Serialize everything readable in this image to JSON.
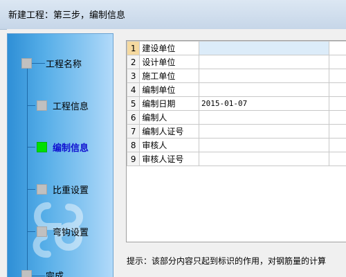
{
  "window": {
    "title": "新建工程：第三步，编制信息"
  },
  "steps": [
    {
      "label": "工程名称",
      "active": false
    },
    {
      "label": "工程信息",
      "active": false
    },
    {
      "label": "编制信息",
      "active": true
    },
    {
      "label": "比重设置",
      "active": false
    },
    {
      "label": "弯钩设置",
      "active": false
    },
    {
      "label": "完成",
      "active": false
    }
  ],
  "grid": {
    "rows": [
      {
        "num": "1",
        "name": "建设单位",
        "value": ""
      },
      {
        "num": "2",
        "name": "设计单位",
        "value": ""
      },
      {
        "num": "3",
        "name": "施工单位",
        "value": ""
      },
      {
        "num": "4",
        "name": "编制单位",
        "value": ""
      },
      {
        "num": "5",
        "name": "编制日期",
        "value": "2015-01-07"
      },
      {
        "num": "6",
        "name": "编制人",
        "value": ""
      },
      {
        "num": "7",
        "name": "编制人证号",
        "value": ""
      },
      {
        "num": "8",
        "name": "审核人",
        "value": ""
      },
      {
        "num": "9",
        "name": "审核人证号",
        "value": ""
      }
    ]
  },
  "hint": "提示：该部分内容只起到标识的作用，对钢筋量的计算",
  "colors": {
    "active_step_box": "#00e000",
    "active_step_label": "#1010d0",
    "sidebar": "#56aee8"
  },
  "icons": {
    "logo": "glodon-logo-icon"
  }
}
